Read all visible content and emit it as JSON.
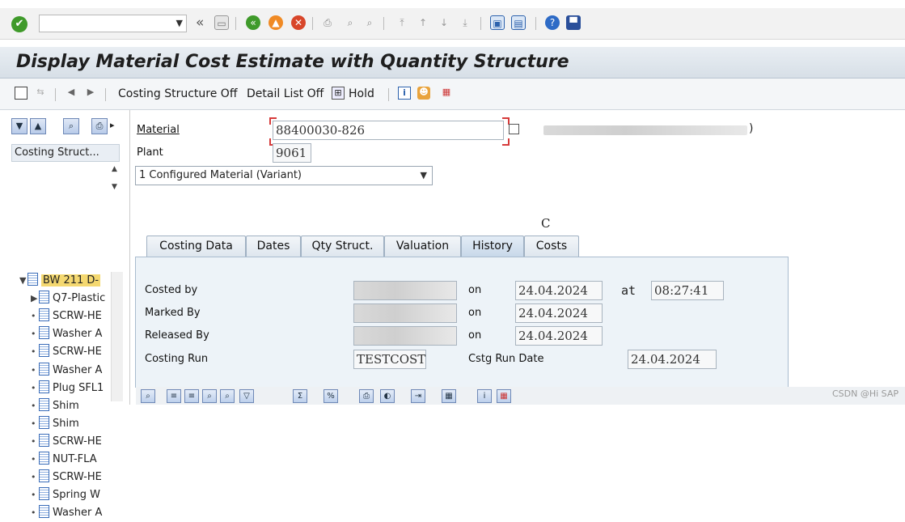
{
  "toolbar": {
    "ok_icon": "check-icon",
    "command_field": {
      "value": "",
      "placeholder": ""
    },
    "rewind_glyph": "«"
  },
  "title": "Display Material Cost Estimate with Quantity Structure",
  "app_toolbar": {
    "costing_structure_off": "Costing Structure Off",
    "detail_list_off": "Detail List Off",
    "hold": "Hold"
  },
  "left_panel": {
    "tree_header": "Costing Struct...",
    "tree": [
      {
        "label": "BW 211 D-",
        "level": 0,
        "marker": "▼"
      },
      {
        "label": "Q7-Plastic",
        "level": 1,
        "marker": "▶"
      },
      {
        "label": "SCRW-HE",
        "level": 1,
        "marker": "•"
      },
      {
        "label": "Washer A",
        "level": 1,
        "marker": "•"
      },
      {
        "label": "SCRW-HE",
        "level": 1,
        "marker": "•"
      },
      {
        "label": "Washer A",
        "level": 1,
        "marker": "•"
      },
      {
        "label": "Plug SFL1",
        "level": 1,
        "marker": "•"
      },
      {
        "label": "Shim",
        "level": 1,
        "marker": "•"
      },
      {
        "label": "Shim",
        "level": 1,
        "marker": "•"
      },
      {
        "label": "SCRW-HE",
        "level": 1,
        "marker": "•"
      },
      {
        "label": "NUT-FLA",
        "level": 1,
        "marker": "•"
      },
      {
        "label": "SCRW-HE",
        "level": 1,
        "marker": "•"
      },
      {
        "label": "Spring W",
        "level": 1,
        "marker": "•"
      },
      {
        "label": "Washer A",
        "level": 1,
        "marker": "•"
      }
    ]
  },
  "form": {
    "material_label": "Material",
    "material_value": "88400030-826",
    "material_desc_tail": ")",
    "plant_label": "Plant",
    "plant_value": "9061",
    "variant_select": "1 Configured Material (Variant)",
    "stray_char": "C"
  },
  "tabs": [
    {
      "label": "Costing Data",
      "active": false
    },
    {
      "label": "Dates",
      "active": false
    },
    {
      "label": "Qty Struct.",
      "active": false
    },
    {
      "label": "Valuation",
      "active": false
    },
    {
      "label": "History",
      "active": true
    },
    {
      "label": "Costs",
      "active": false
    }
  ],
  "history": {
    "costed_by_label": "Costed by",
    "marked_by_label": "Marked By",
    "released_by_label": "Released By",
    "costing_run_label": "Costing Run",
    "on_label": "on",
    "at_label": "at",
    "costed_on": "24.04.2024",
    "costed_at": "08:27:41",
    "marked_on": "24.04.2024",
    "released_on": "24.04.2024",
    "costing_run_value": "TESTCOST",
    "cstg_run_date_label": "Cstg Run Date",
    "cstg_run_date_value": "24.04.2024"
  },
  "watermark": "CSDN @Hi SAP",
  "colors": {
    "accent_green": "#3f9a2a",
    "title_bg": "#dfe6ed",
    "tab_panel_bg": "#edf3f8",
    "crop_marker": "#d63a3a"
  }
}
